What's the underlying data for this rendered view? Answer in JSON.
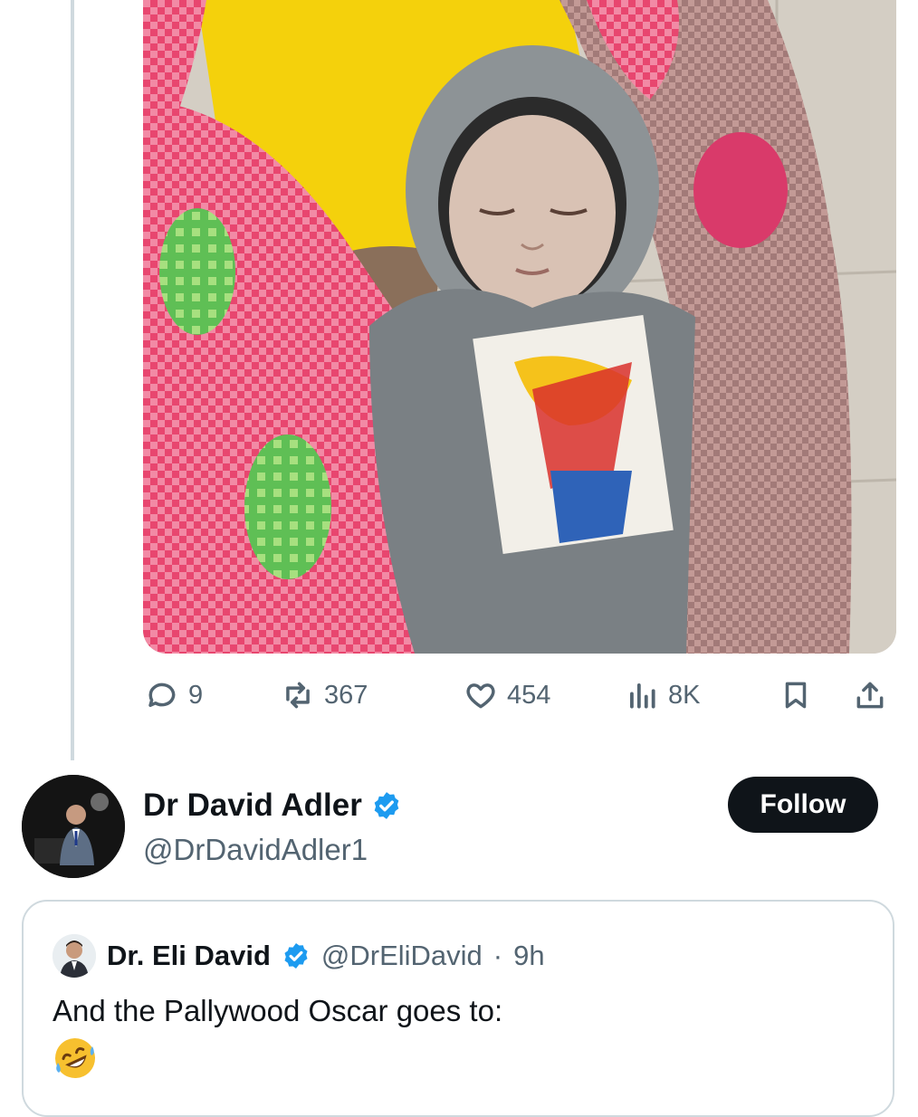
{
  "tweet": {
    "actions": {
      "replies": "9",
      "reposts": "367",
      "likes": "454",
      "views": "8K"
    }
  },
  "author": {
    "name": "Dr David Adler",
    "handle": "@DrDavidAdler1",
    "verified": true,
    "follow_label": "Follow"
  },
  "quoted": {
    "name": "Dr. Eli David",
    "handle": "@DrEliDavid",
    "separator": "·",
    "time": "9h",
    "text": "And the Pallywood Oscar goes to:",
    "emoji": "rolling-on-floor-laughing"
  },
  "colors": {
    "accent": "#1d9bf0",
    "text": "#0f1419",
    "muted": "#536471",
    "border": "#cfd9de"
  }
}
